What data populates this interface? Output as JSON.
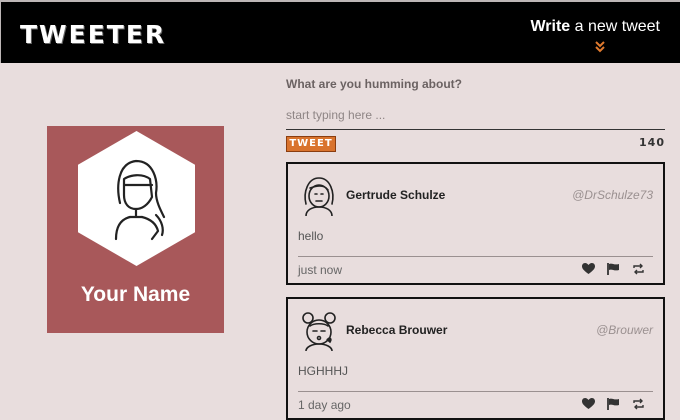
{
  "header": {
    "logo": "TWEETER",
    "write_bold": "Write",
    "write_rest": " a new tweet"
  },
  "profile": {
    "name": "Your Name"
  },
  "compose": {
    "label": "What are you humming about?",
    "placeholder": "start typing here ...",
    "value": "",
    "button_label": "TWEET",
    "counter": "140"
  },
  "tweets": [
    {
      "author": "Gertrude Schulze",
      "handle": "@DrSchulze73",
      "text": "hello",
      "time": "just now"
    },
    {
      "author": "Rebecca Brouwer",
      "handle": "@Brouwer",
      "text": "HGHHHJ",
      "time": "1 day ago"
    }
  ],
  "colors": {
    "accent": "#d9732d",
    "profile_bg": "#a8585a",
    "page_bg": "#e8dddd"
  }
}
